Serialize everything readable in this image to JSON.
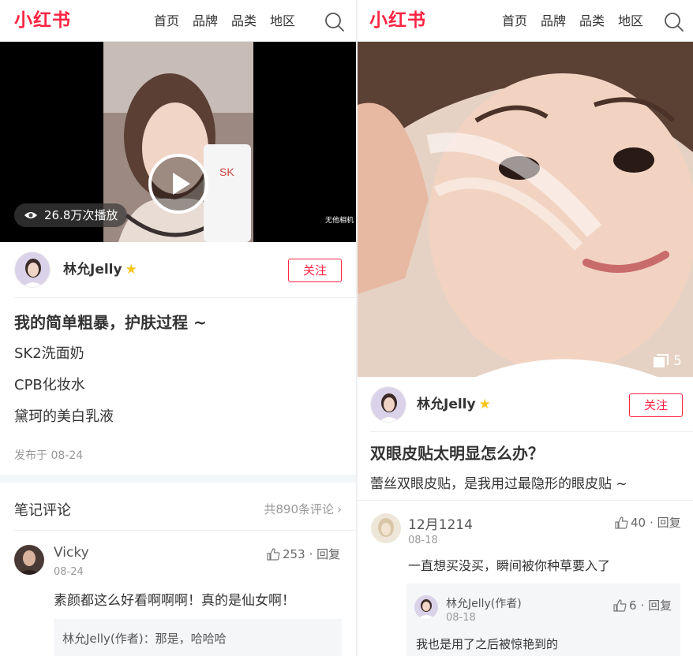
{
  "left": {
    "header": {
      "logo": "小红书",
      "nav": [
        "首页",
        "品牌",
        "品类",
        "地区"
      ]
    },
    "video": {
      "views": "26.8万次播放",
      "watermark": "无他相机"
    },
    "author": {
      "name": "林允Jelly",
      "follow": "关注"
    },
    "post": {
      "title": "我的简单粗暴，护肤过程 ~",
      "lines": [
        "SK2洗面奶",
        "CPB化妆水",
        "黛珂的美白乳液"
      ],
      "published": "发布于 08-24"
    },
    "comments_header": {
      "title": "笔记评论",
      "count": "共890条评论"
    },
    "comment": {
      "user": "Vicky",
      "date": "08-24",
      "likes": "253",
      "reply_label": "· 回复",
      "text": "素颜都这么好看啊啊啊！真的是仙女啊！",
      "reply": "林允Jelly(作者)：那是，哈哈哈"
    }
  },
  "right": {
    "header": {
      "logo": "小红书",
      "nav": [
        "首页",
        "品牌",
        "品类",
        "地区"
      ]
    },
    "image": {
      "count": "5"
    },
    "author": {
      "name": "林允Jelly",
      "follow": "关注"
    },
    "post": {
      "title": "双眼皮贴太明显怎么办？",
      "text": "蕾丝双眼皮贴，是我用过最隐形的眼皮贴 ~"
    },
    "comment": {
      "user": "12月1214",
      "date": "08-18",
      "likes": "40",
      "reply_label": "· 回复",
      "text": "一直想买没买，瞬间被你种草要入了",
      "reply": {
        "user": "林允Jelly(作者)",
        "date": "08-18",
        "likes": "6",
        "reply_label": "· 回复",
        "text": "我也是用了之后被惊艳到的"
      }
    }
  },
  "colors": {
    "brand": "#ff2442",
    "star": "#f5c518"
  }
}
